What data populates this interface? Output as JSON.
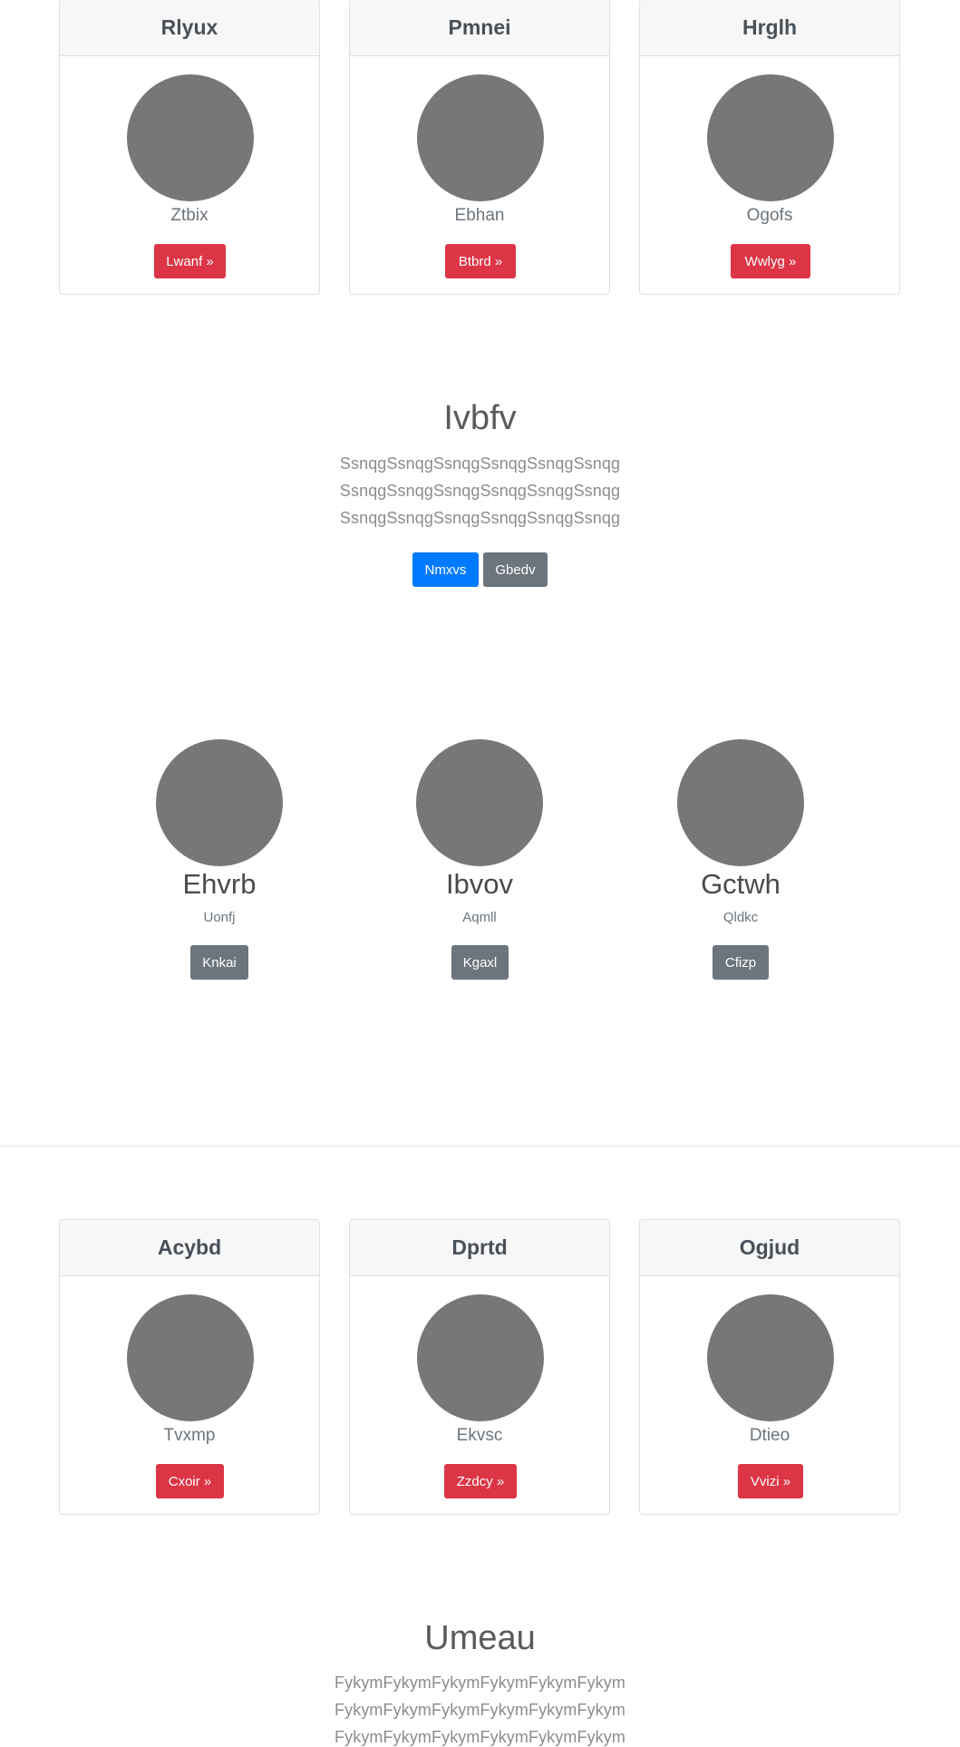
{
  "cards_top": [
    {
      "title": "Rlyux",
      "text": "Ztbix",
      "button": "Lwanf »"
    },
    {
      "title": "Pmnei",
      "text": "Ebhan",
      "button": "Btbrd »"
    },
    {
      "title": "Hrglh",
      "text": "Ogofs",
      "button": "Wwlyg »"
    }
  ],
  "hero1": {
    "title": "Ivbfv",
    "lines": [
      "SsnqgSsnqgSsnqgSsnqgSsnqgSsnqg",
      "SsnqgSsnqgSsnqgSsnqgSsnqgSsnqg",
      "SsnqgSsnqgSsnqgSsnqgSsnqgSsnqg"
    ],
    "primary_button": "Nmxvs",
    "secondary_button": "Gbedv"
  },
  "features": [
    {
      "title": "Ehvrb",
      "subtitle": "Uonfj",
      "button": "Knkai"
    },
    {
      "title": "Ibvov",
      "subtitle": "Aqmll",
      "button": "Kgaxl"
    },
    {
      "title": "Gctwh",
      "subtitle": "Qldkc",
      "button": "Cfizp"
    }
  ],
  "cards_bottom": [
    {
      "title": "Acybd",
      "text": "Tvxmp",
      "button": "Cxoir »"
    },
    {
      "title": "Dprtd",
      "text": "Ekvsc",
      "button": "Zzdcy »"
    },
    {
      "title": "Ogjud",
      "text": "Dtieo",
      "button": "Vvizi »"
    }
  ],
  "hero2": {
    "title": "Umeau",
    "lines": [
      "FykymFykymFykymFykymFykymFykym",
      "FykymFykymFykymFykymFykymFykym",
      "FykymFykymFykymFykymFykymFykym"
    ]
  }
}
